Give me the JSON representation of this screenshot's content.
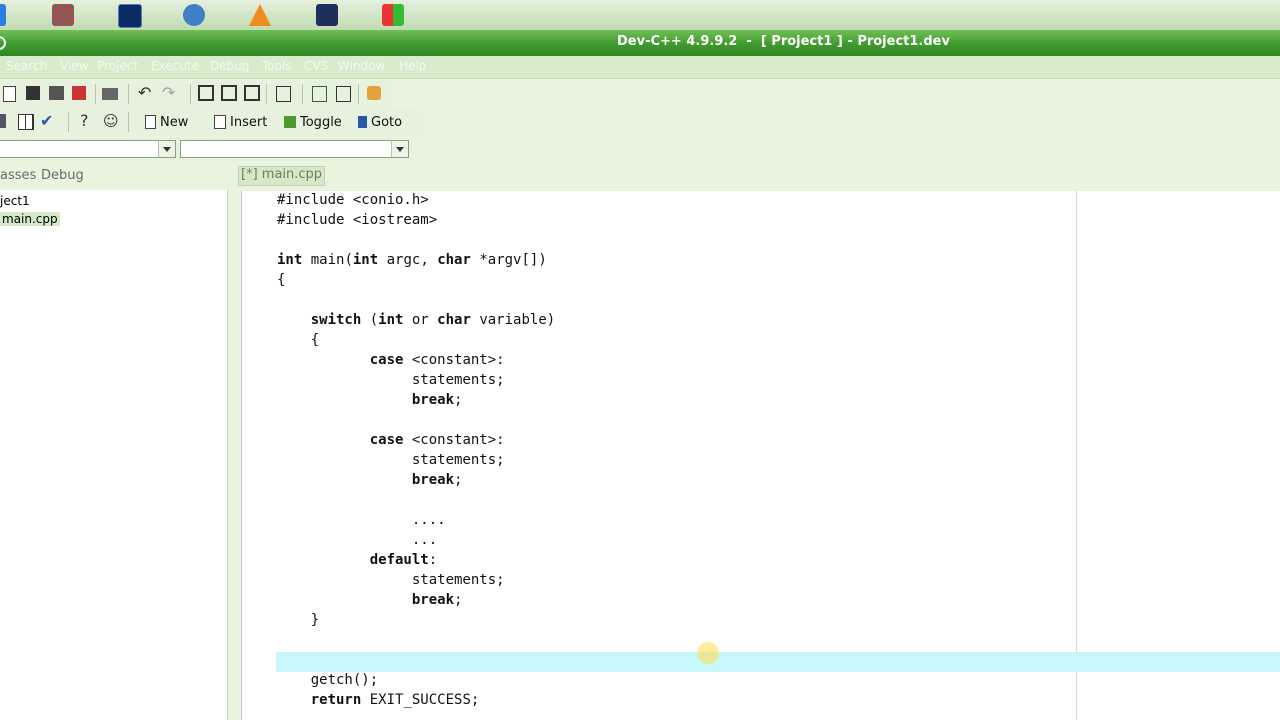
{
  "window": {
    "title": "Dev-C++ 4.9.9.2  -  [ Project1 ] - Project1.dev"
  },
  "menu": {
    "items": [
      "Search",
      "View",
      "Project",
      "Execute",
      "Debug",
      "Tools",
      "CVS",
      "Window",
      "Help"
    ]
  },
  "toolbar2": {
    "new_label": "New",
    "insert_label": "Insert",
    "toggle_label": "Toggle",
    "goto_label": "Goto"
  },
  "left_panel": {
    "tabs": [
      "asses",
      "Debug"
    ],
    "tree": [
      "ject1",
      "main.cpp"
    ]
  },
  "editor": {
    "tab_label": "[*] main.cpp",
    "lines": [
      "#include <conio.h>",
      "#include <iostream>",
      "",
      "int main(int argc, char *argv[])",
      "{",
      "",
      "    switch (int or char variable)",
      "    {",
      "           case <constant>:",
      "                statements;",
      "                break;",
      "",
      "           case <constant>:",
      "                statements;",
      "                break;",
      "",
      "                ....",
      "                ...",
      "           default:",
      "                statements;",
      "                break;",
      "    }",
      "",
      "",
      "    getch();",
      "    return EXIT_SUCCESS;"
    ]
  },
  "colors": {
    "title_bar": "#3f9a2e",
    "current_line": "#c8f7fb"
  }
}
